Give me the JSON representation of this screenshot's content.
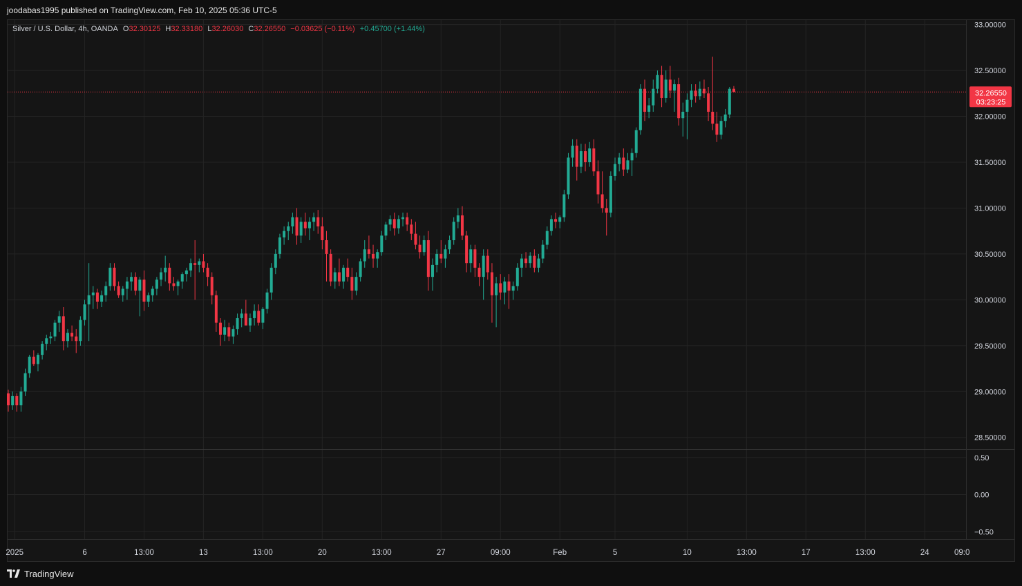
{
  "header": {
    "publish_line": "joodabas1995 published on TradingView.com, Feb 10, 2025 05:36 UTC-5"
  },
  "legend": {
    "symbol": "Silver / U.S. Dollar, 4h, OANDA",
    "o_label": "O",
    "o_value": "32.30125",
    "h_label": "H",
    "h_value": "32.33180",
    "l_label": "L",
    "l_value": "32.26030",
    "c_label": "C",
    "c_value": "32.26550",
    "change": "−0.03625 (−0.11%)",
    "change2": "+0.45700 (+1.44%)"
  },
  "price_tag": {
    "price": "32.26550",
    "countdown": "03:23:25"
  },
  "footer": {
    "brand": "TradingView"
  },
  "colors": {
    "up": "#22ab94",
    "down": "#f23645",
    "background": "#151515",
    "grid": "#242424"
  },
  "chart_data": {
    "type": "candlestick",
    "symbol": "Silver / U.S. Dollar",
    "interval": "4h",
    "ylim": [
      28.37,
      33.05
    ],
    "y_ticks": [
      {
        "v": 33.0,
        "label": "33.00000"
      },
      {
        "v": 32.5,
        "label": "32.50000"
      },
      {
        "v": 32.0,
        "label": "32.00000"
      },
      {
        "v": 31.5,
        "label": "31.50000"
      },
      {
        "v": 31.0,
        "label": "31.00000"
      },
      {
        "v": 30.5,
        "label": "30.50000"
      },
      {
        "v": 30.0,
        "label": "30.00000"
      },
      {
        "v": 29.5,
        "label": "29.50000"
      },
      {
        "v": 29.0,
        "label": "29.00000"
      },
      {
        "v": 28.5,
        "label": "28.50000"
      }
    ],
    "lower_pane": {
      "ylim": [
        -0.6,
        0.6
      ],
      "y_ticks": [
        {
          "v": 0.5,
          "label": "0.50"
        },
        {
          "v": 0.0,
          "label": "0.00"
        },
        {
          "v": -0.5,
          "label": "−0.50"
        }
      ]
    },
    "x_ticks": [
      {
        "bar": 1.5,
        "label": "2025"
      },
      {
        "bar": 18,
        "label": "6"
      },
      {
        "bar": 32,
        "label": "13:00"
      },
      {
        "bar": 46,
        "label": "13"
      },
      {
        "bar": 60,
        "label": "13:00"
      },
      {
        "bar": 74,
        "label": "20"
      },
      {
        "bar": 88,
        "label": "13:00"
      },
      {
        "bar": 102,
        "label": "27"
      },
      {
        "bar": 116,
        "label": "09:00"
      },
      {
        "bar": 130,
        "label": "Feb"
      },
      {
        "bar": 143,
        "label": "5"
      },
      {
        "bar": 160,
        "label": "10"
      },
      {
        "bar": 174,
        "label": "13:00"
      },
      {
        "bar": 188,
        "label": "17"
      },
      {
        "bar": 202,
        "label": "13:00"
      },
      {
        "bar": 216,
        "label": "24"
      },
      {
        "bar": 230,
        "label": "09:0"
      }
    ],
    "last_price": 32.2655,
    "candles": [
      [
        28.98,
        29.02,
        28.78,
        28.85
      ],
      [
        28.85,
        29.0,
        28.8,
        28.95
      ],
      [
        28.95,
        28.98,
        28.78,
        28.85
      ],
      [
        28.85,
        29.05,
        28.78,
        29.0
      ],
      [
        29.0,
        29.25,
        28.95,
        29.2
      ],
      [
        29.2,
        29.4,
        29.15,
        29.38
      ],
      [
        29.38,
        29.45,
        29.28,
        29.3
      ],
      [
        29.3,
        29.42,
        29.22,
        29.4
      ],
      [
        29.4,
        29.55,
        29.35,
        29.52
      ],
      [
        29.52,
        29.62,
        29.45,
        29.58
      ],
      [
        29.58,
        29.65,
        29.52,
        29.6
      ],
      [
        29.6,
        29.78,
        29.55,
        29.75
      ],
      [
        29.75,
        29.88,
        29.65,
        29.82
      ],
      [
        29.82,
        29.92,
        29.45,
        29.55
      ],
      [
        29.55,
        29.68,
        29.48,
        29.64
      ],
      [
        29.64,
        29.72,
        29.55,
        29.6
      ],
      [
        29.6,
        29.68,
        29.42,
        29.55
      ],
      [
        29.55,
        29.82,
        29.5,
        29.78
      ],
      [
        29.78,
        30.0,
        29.72,
        29.95
      ],
      [
        29.95,
        30.4,
        29.55,
        30.05
      ],
      [
        30.05,
        30.15,
        29.9,
        30.08
      ],
      [
        30.08,
        30.12,
        29.9,
        29.98
      ],
      [
        29.98,
        30.1,
        29.92,
        30.05
      ],
      [
        30.05,
        30.2,
        29.98,
        30.15
      ],
      [
        30.15,
        30.4,
        30.1,
        30.35
      ],
      [
        30.35,
        30.4,
        30.1,
        30.15
      ],
      [
        30.15,
        30.2,
        30.02,
        30.05
      ],
      [
        30.05,
        30.15,
        29.98,
        30.12
      ],
      [
        30.12,
        30.25,
        30.0,
        30.2
      ],
      [
        30.2,
        30.3,
        30.1,
        30.25
      ],
      [
        30.25,
        30.3,
        30.05,
        30.1
      ],
      [
        30.1,
        30.25,
        29.82,
        30.22
      ],
      [
        30.22,
        30.32,
        29.88,
        29.98
      ],
      [
        29.98,
        30.08,
        29.92,
        30.05
      ],
      [
        30.05,
        30.15,
        29.98,
        30.12
      ],
      [
        30.12,
        30.25,
        30.05,
        30.22
      ],
      [
        30.22,
        30.35,
        30.15,
        30.3
      ],
      [
        30.3,
        30.48,
        30.2,
        30.35
      ],
      [
        30.35,
        30.4,
        30.1,
        30.18
      ],
      [
        30.18,
        30.25,
        30.1,
        30.15
      ],
      [
        30.15,
        30.22,
        30.05,
        30.2
      ],
      [
        30.2,
        30.3,
        30.12,
        30.28
      ],
      [
        30.28,
        30.35,
        30.2,
        30.32
      ],
      [
        30.32,
        30.45,
        30.25,
        30.4
      ],
      [
        30.4,
        30.65,
        30.0,
        30.38
      ],
      [
        30.38,
        30.45,
        30.3,
        30.42
      ],
      [
        30.42,
        30.5,
        30.3,
        30.35
      ],
      [
        30.35,
        30.4,
        30.15,
        30.25
      ],
      [
        30.25,
        30.3,
        29.95,
        30.05
      ],
      [
        30.05,
        30.1,
        29.65,
        29.75
      ],
      [
        29.75,
        29.8,
        29.5,
        29.62
      ],
      [
        29.62,
        29.78,
        29.55,
        29.7
      ],
      [
        29.7,
        29.75,
        29.55,
        29.6
      ],
      [
        29.6,
        29.72,
        29.52,
        29.68
      ],
      [
        29.68,
        29.85,
        29.62,
        29.8
      ],
      [
        29.8,
        29.9,
        29.7,
        29.85
      ],
      [
        29.85,
        30.0,
        29.75,
        29.72
      ],
      [
        29.72,
        29.85,
        29.65,
        29.8
      ],
      [
        29.8,
        29.95,
        29.72,
        29.88
      ],
      [
        29.88,
        29.95,
        29.72,
        29.75
      ],
      [
        29.75,
        29.92,
        29.68,
        29.9
      ],
      [
        29.9,
        30.12,
        29.85,
        30.08
      ],
      [
        30.08,
        30.4,
        30.0,
        30.35
      ],
      [
        30.35,
        30.55,
        30.28,
        30.5
      ],
      [
        30.5,
        30.72,
        30.45,
        30.68
      ],
      [
        30.68,
        30.8,
        30.6,
        30.75
      ],
      [
        30.75,
        30.85,
        30.65,
        30.8
      ],
      [
        30.8,
        30.95,
        30.72,
        30.9
      ],
      [
        30.9,
        31.0,
        30.6,
        30.7
      ],
      [
        30.7,
        30.9,
        30.62,
        30.85
      ],
      [
        30.85,
        30.95,
        30.7,
        30.78
      ],
      [
        30.78,
        30.9,
        30.65,
        30.85
      ],
      [
        30.85,
        30.95,
        30.75,
        30.9
      ],
      [
        30.9,
        30.98,
        30.72,
        30.8
      ],
      [
        30.8,
        30.9,
        30.55,
        30.65
      ],
      [
        30.65,
        30.75,
        30.2,
        30.5
      ],
      [
        30.5,
        30.55,
        30.15,
        30.2
      ],
      [
        30.2,
        30.35,
        30.12,
        30.3
      ],
      [
        30.3,
        30.45,
        30.15,
        30.2
      ],
      [
        30.2,
        30.38,
        30.12,
        30.35
      ],
      [
        30.35,
        30.45,
        30.2,
        30.25
      ],
      [
        30.25,
        30.35,
        30.0,
        30.1
      ],
      [
        30.1,
        30.3,
        30.05,
        30.25
      ],
      [
        30.25,
        30.45,
        30.2,
        30.42
      ],
      [
        30.42,
        30.65,
        30.35,
        30.55
      ],
      [
        30.55,
        30.7,
        30.45,
        30.5
      ],
      [
        30.5,
        30.6,
        30.35,
        30.45
      ],
      [
        30.45,
        30.55,
        30.35,
        30.52
      ],
      [
        30.52,
        30.75,
        30.48,
        30.7
      ],
      [
        30.7,
        30.85,
        30.65,
        30.82
      ],
      [
        30.82,
        30.92,
        30.75,
        30.88
      ],
      [
        30.88,
        30.95,
        30.7,
        30.78
      ],
      [
        30.78,
        30.92,
        30.72,
        30.88
      ],
      [
        30.88,
        30.95,
        30.8,
        30.9
      ],
      [
        30.9,
        30.95,
        30.75,
        30.82
      ],
      [
        30.82,
        30.88,
        30.65,
        30.72
      ],
      [
        30.72,
        30.85,
        30.55,
        30.6
      ],
      [
        30.6,
        30.7,
        30.45,
        30.52
      ],
      [
        30.52,
        30.7,
        30.48,
        30.65
      ],
      [
        30.65,
        30.75,
        30.1,
        30.25
      ],
      [
        30.25,
        30.45,
        30.1,
        30.38
      ],
      [
        30.38,
        30.55,
        30.3,
        30.5
      ],
      [
        30.5,
        30.65,
        30.4,
        30.45
      ],
      [
        30.45,
        30.6,
        30.35,
        30.55
      ],
      [
        30.55,
        30.7,
        30.5,
        30.65
      ],
      [
        30.65,
        30.9,
        30.6,
        30.85
      ],
      [
        30.85,
        31.0,
        30.78,
        30.92
      ],
      [
        30.92,
        31.02,
        30.65,
        30.7
      ],
      [
        30.7,
        30.75,
        30.3,
        30.4
      ],
      [
        30.4,
        30.6,
        30.3,
        30.55
      ],
      [
        30.55,
        30.6,
        30.25,
        30.35
      ],
      [
        30.35,
        30.4,
        30.15,
        30.25
      ],
      [
        30.25,
        30.55,
        30.0,
        30.48
      ],
      [
        30.48,
        30.55,
        30.22,
        30.3
      ],
      [
        30.3,
        30.4,
        29.75,
        30.05
      ],
      [
        30.05,
        30.25,
        29.7,
        30.18
      ],
      [
        30.18,
        30.28,
        30.0,
        30.08
      ],
      [
        30.08,
        30.25,
        29.95,
        30.2
      ],
      [
        30.2,
        30.28,
        29.9,
        30.1
      ],
      [
        30.1,
        30.2,
        30.0,
        30.15
      ],
      [
        30.15,
        30.4,
        30.1,
        30.35
      ],
      [
        30.35,
        30.5,
        30.25,
        30.45
      ],
      [
        30.45,
        30.52,
        30.35,
        30.4
      ],
      [
        30.4,
        30.52,
        30.35,
        30.48
      ],
      [
        30.48,
        30.55,
        30.3,
        30.35
      ],
      [
        30.35,
        30.5,
        30.3,
        30.45
      ],
      [
        30.45,
        30.65,
        30.4,
        30.6
      ],
      [
        30.6,
        30.8,
        30.55,
        30.75
      ],
      [
        30.75,
        30.92,
        30.7,
        30.88
      ],
      [
        30.88,
        30.95,
        30.78,
        30.85
      ],
      [
        30.85,
        30.92,
        30.78,
        30.9
      ],
      [
        30.9,
        31.2,
        30.85,
        31.15
      ],
      [
        31.15,
        31.6,
        31.1,
        31.55
      ],
      [
        31.55,
        31.75,
        31.45,
        31.68
      ],
      [
        31.68,
        31.75,
        31.3,
        31.45
      ],
      [
        31.45,
        31.7,
        31.38,
        31.62
      ],
      [
        31.62,
        31.7,
        31.4,
        31.5
      ],
      [
        31.5,
        31.72,
        31.45,
        31.65
      ],
      [
        31.65,
        31.75,
        31.35,
        31.4
      ],
      [
        31.4,
        31.52,
        31.05,
        31.15
      ],
      [
        31.15,
        31.4,
        30.95,
        31.0
      ],
      [
        31.0,
        31.1,
        30.7,
        30.95
      ],
      [
        30.95,
        31.4,
        30.9,
        31.35
      ],
      [
        31.35,
        31.55,
        31.3,
        31.48
      ],
      [
        31.48,
        31.6,
        31.4,
        31.55
      ],
      [
        31.55,
        31.65,
        31.35,
        31.42
      ],
      [
        31.42,
        31.6,
        31.38,
        31.52
      ],
      [
        31.52,
        31.65,
        31.35,
        31.6
      ],
      [
        31.6,
        31.88,
        31.55,
        31.85
      ],
      [
        31.85,
        32.35,
        31.8,
        32.3
      ],
      [
        32.3,
        32.4,
        31.95,
        32.05
      ],
      [
        32.05,
        32.2,
        31.98,
        32.12
      ],
      [
        32.12,
        32.4,
        32.05,
        32.3
      ],
      [
        32.3,
        32.5,
        32.25,
        32.45
      ],
      [
        32.45,
        32.55,
        32.1,
        32.2
      ],
      [
        32.2,
        32.5,
        32.15,
        32.4
      ],
      [
        32.4,
        32.55,
        32.2,
        32.28
      ],
      [
        32.28,
        32.4,
        32.05,
        32.35
      ],
      [
        32.35,
        32.42,
        31.9,
        31.98
      ],
      [
        31.98,
        32.15,
        31.78,
        32.05
      ],
      [
        32.05,
        32.25,
        31.75,
        32.18
      ],
      [
        32.18,
        32.35,
        32.1,
        32.28
      ],
      [
        32.28,
        32.35,
        32.15,
        32.22
      ],
      [
        32.22,
        32.38,
        32.18,
        32.3
      ],
      [
        32.3,
        32.4,
        32.2,
        32.25
      ],
      [
        32.25,
        32.32,
        31.95,
        32.05
      ],
      [
        32.05,
        32.65,
        31.85,
        31.92
      ],
      [
        31.92,
        32.05,
        31.72,
        31.8
      ],
      [
        31.8,
        32.0,
        31.75,
        31.95
      ],
      [
        31.95,
        32.08,
        31.88,
        32.02
      ],
      [
        32.02,
        32.32,
        31.98,
        32.3
      ],
      [
        32.3,
        32.33,
        32.26,
        32.2655
      ]
    ]
  }
}
